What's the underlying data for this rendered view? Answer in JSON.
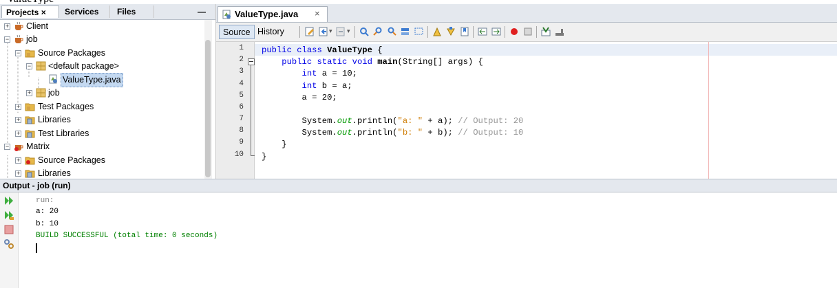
{
  "projects_panel": {
    "tabs": [
      {
        "label": "Projects ×"
      },
      {
        "label": "Services"
      },
      {
        "label": "Files"
      }
    ],
    "minimize_label": "—",
    "tree": [
      {
        "label": "Client"
      },
      {
        "label": "job"
      },
      {
        "label": "Source Packages"
      },
      {
        "label": "<default package>"
      },
      {
        "label": "ValueType.java"
      },
      {
        "label": "job"
      },
      {
        "label": "Test Packages"
      },
      {
        "label": "Libraries"
      },
      {
        "label": "Test Libraries"
      },
      {
        "label": "Matrix"
      },
      {
        "label": "Source Packages"
      },
      {
        "label": "Libraries"
      }
    ]
  },
  "editor": {
    "tab_title": "ValueType.java",
    "tab_close": "×",
    "source_label": "Source",
    "history_label": "History",
    "line_numbers": [
      "1",
      "2",
      "3",
      "4",
      "5",
      "6",
      "7",
      "8",
      "9",
      "10"
    ],
    "code": {
      "l1_kw": "public class ",
      "l1_name": "ValueType",
      "l1_end": " {",
      "l2_kw": "public static void ",
      "l2_name": "main",
      "l2_end": "(String[] args) {",
      "l3_kw": "int",
      "l3_rest": " a = 10;",
      "l4_kw": "int",
      "l4_rest": " b = a;",
      "l5": "a = 20;",
      "l7_pre": "System.",
      "l7_out": "out",
      "l7_call": ".println(",
      "l7_str": "\"a: \"",
      "l7_post": " + a); ",
      "l7_comment": "// Output: 20",
      "l8_pre": "System.",
      "l8_out": "out",
      "l8_call": ".println(",
      "l8_str": "\"b: \"",
      "l8_post": " + b); ",
      "l8_comment": "// Output: 10",
      "l9": "}",
      "l10": "}"
    }
  },
  "output": {
    "title": "Output - job (run)",
    "lines": [
      "run:",
      "a: 20",
      "b: 10",
      "BUILD SUCCESSFUL (total time: 0 seconds)"
    ]
  },
  "colors": {
    "keyword": "#0000e6",
    "string": "#ce7b00",
    "comment": "#969696",
    "field": "#009900",
    "build_success": "#008000",
    "run_text": "#808080"
  }
}
